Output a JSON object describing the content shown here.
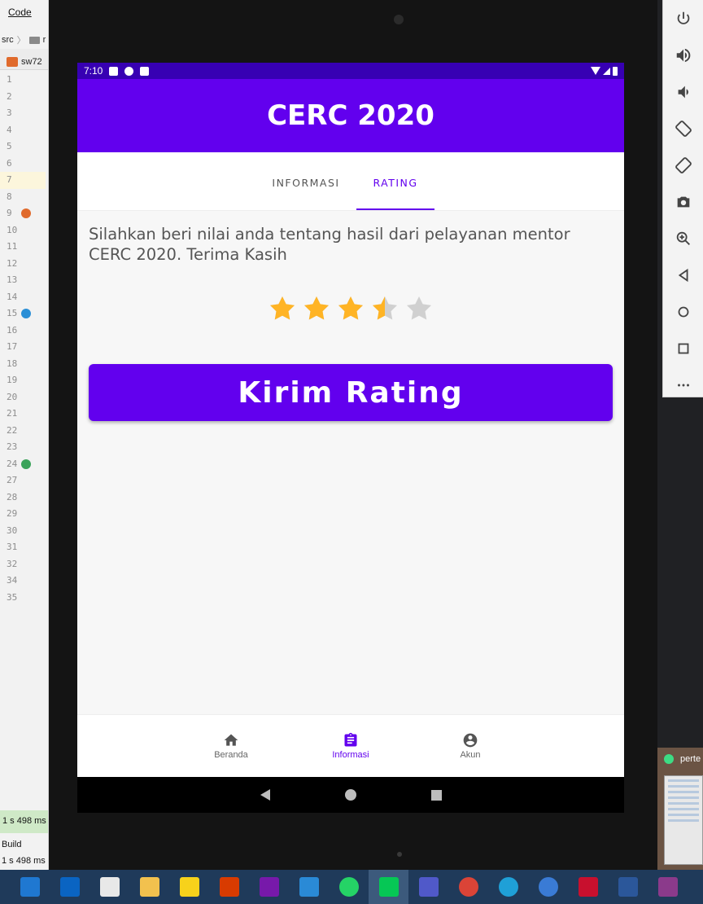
{
  "ide": {
    "menu_code": "Code",
    "crumb_src": "src",
    "crumb_next": "r",
    "tab_label": "sw72",
    "line_numbers": [
      "1",
      "2",
      "3",
      "4",
      "5",
      "6",
      "7",
      "8",
      "9",
      "10",
      "11",
      "12",
      "13",
      "14",
      "15",
      "16",
      "17",
      "18",
      "19",
      "20",
      "21",
      "22",
      "23",
      "24",
      "27",
      "28",
      "29",
      "30",
      "31",
      "32",
      "34",
      "35"
    ],
    "status_time": "1 s 498 ms",
    "build_label": "Build",
    "build_time": "1 s 498 ms"
  },
  "phone": {
    "status_time": "7:10",
    "app_title": "CERC 2020",
    "tabs": [
      {
        "label": "INFORMASI",
        "active": false
      },
      {
        "label": "RATING",
        "active": true
      }
    ],
    "description": "Silahkan beri nilai anda tentang hasil dari pelayanan mentor CERC 2020. Terima Kasih",
    "rating": {
      "value": 3.5,
      "max": 5
    },
    "submit_label": "Kirim Rating",
    "bottom_nav": [
      {
        "label": "Beranda",
        "icon": "home-icon",
        "active": false
      },
      {
        "label": "Informasi",
        "icon": "clipboard-icon",
        "active": true
      },
      {
        "label": "Akun",
        "icon": "account-icon",
        "active": false
      }
    ]
  },
  "thumbnail": {
    "title": "perte"
  },
  "colors": {
    "primary": "#6200ee",
    "primary_dark": "#3700b3",
    "star": "#ffb425",
    "star_empty": "#d0d0d0"
  }
}
